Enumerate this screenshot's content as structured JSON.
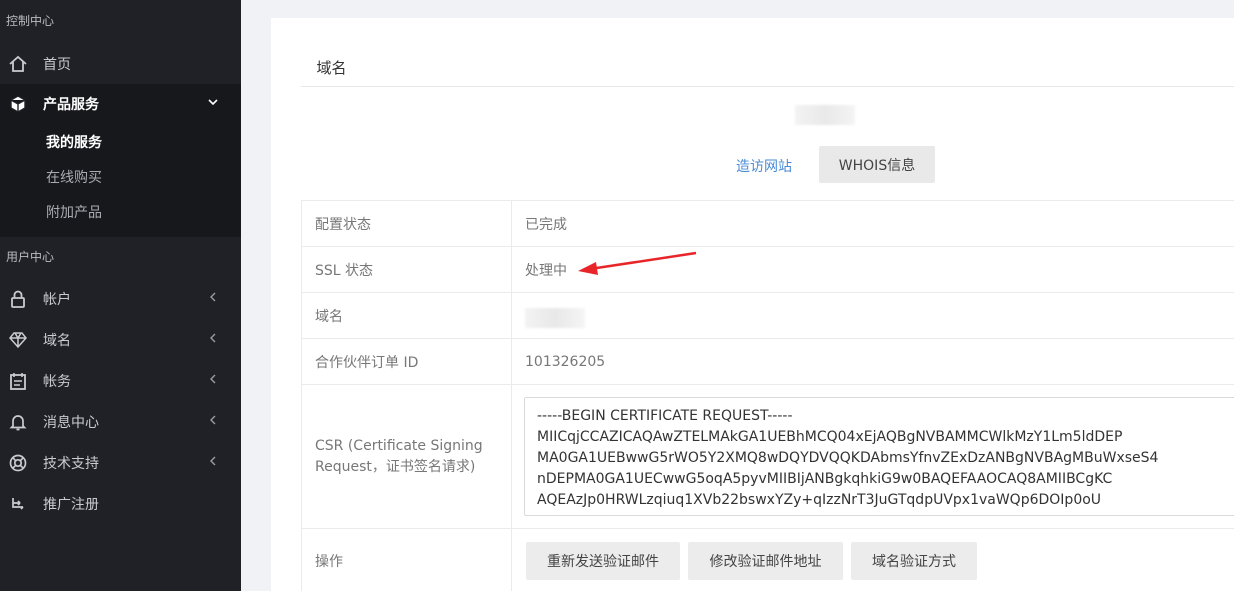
{
  "sidebar": {
    "section_control": "控制中心",
    "home": "首页",
    "products": "产品服务",
    "sub_items": [
      "我的服务",
      "在线购买",
      "附加产品"
    ],
    "section_user": "用户中心",
    "account": "帐户",
    "domain": "域名",
    "billing": "帐务",
    "messages": "消息中心",
    "support": "技术支持",
    "promo": "推广注册"
  },
  "main": {
    "tab_label": "域名",
    "visit_link": "造访网站",
    "whois_button": "WHOIS信息",
    "rows": {
      "config_label": "配置状态",
      "config_value": "已完成",
      "ssl_label": "SSL 状态",
      "ssl_value": "处理中",
      "domain_label": "域名",
      "order_label": "合作伙伴订单 ID",
      "order_value": "101326205",
      "csr_label": "CSR (Certificate Signing Request，证书签名请求)",
      "csr_value": "-----BEGIN CERTIFICATE REQUEST-----\nMIICqjCCAZICAQAwZTELMAkGA1UEBhMCQ04xEjAQBgNVBAMMCWlkMzY1Lm5ldDEP\nMA0GA1UEBwwG5rWO5Y2XMQ8wDQYDVQQKDAbmsYfnvZExDzANBgNVBAgMBuWxseS4\nnDEPMA0GA1UECwwG5oqA5pyvMIIBIjANBgkqhkiG9w0BAQEFAAOCAQ8AMIIBCgKC\nAQEAzJp0HRWLzqiuq1XVb22bswxYZy+qIzzNrT3JuGTqdpUVpx1vaWQp6DOIp0oU",
      "actions_label": "操作"
    },
    "actions": [
      "重新发送验证邮件",
      "修改验证邮件地址",
      "域名验证方式"
    ]
  },
  "colors": {
    "sidebar_bg": "#1f2126",
    "link": "#4a8bd6",
    "arrow": "#e8262a"
  }
}
